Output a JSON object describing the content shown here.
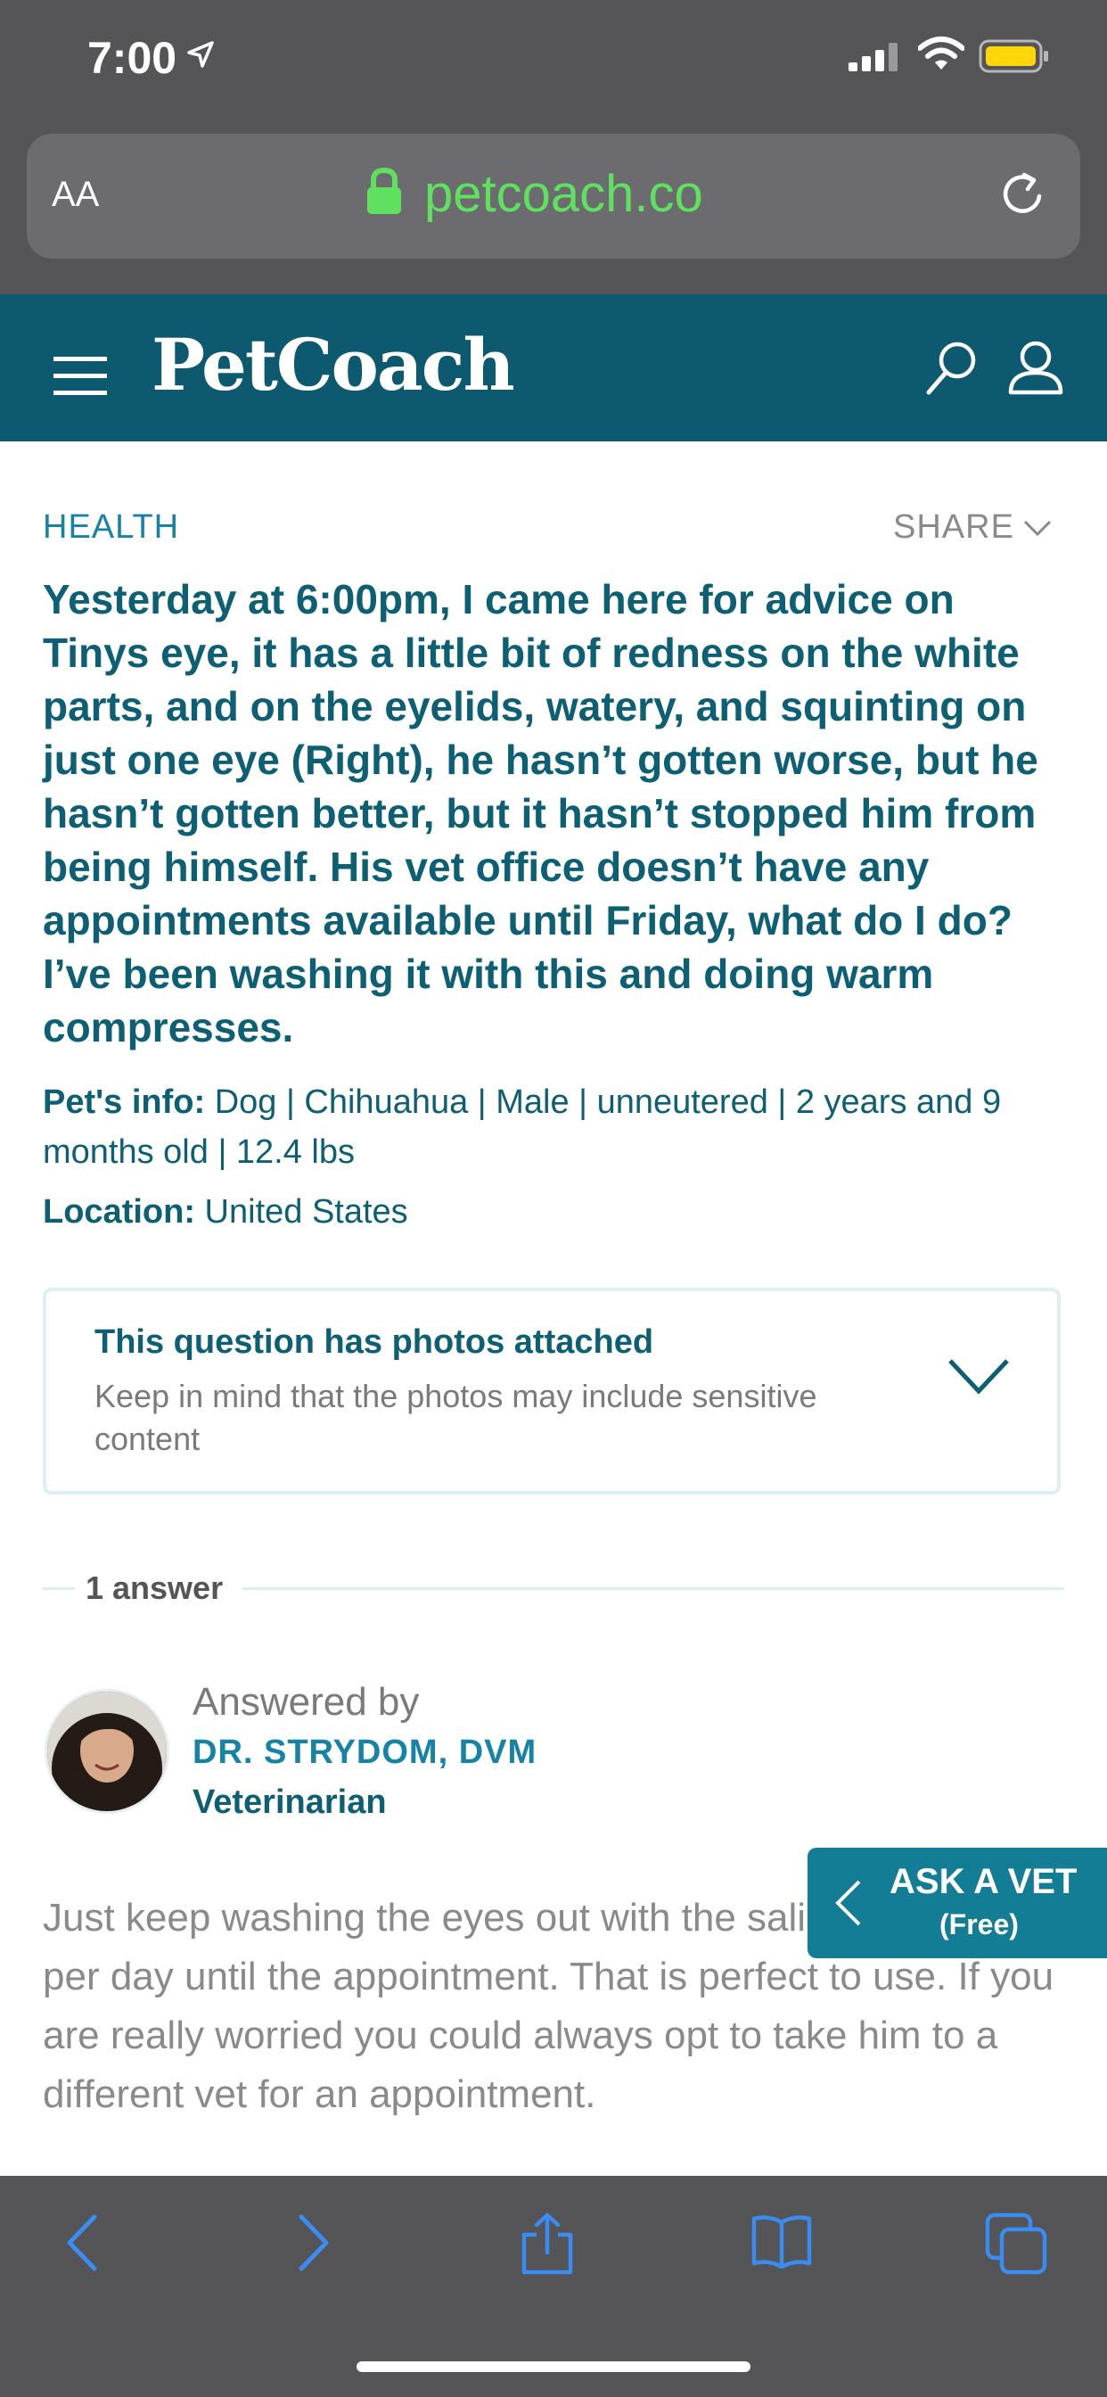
{
  "status_bar": {
    "time": "7:00",
    "icons": [
      "location-arrow-icon",
      "signal-icon",
      "wifi-icon",
      "battery-icon"
    ],
    "battery_color": "#ffd60a"
  },
  "browser": {
    "text_size_label": "AA",
    "url": "petcoach.co",
    "url_color": "#5fe05f",
    "icons": [
      "lock-icon",
      "reload-icon"
    ]
  },
  "site_header": {
    "brand": "PetCoach",
    "background": "#0d5a70",
    "icons": [
      "menu-icon",
      "search-icon",
      "user-icon"
    ]
  },
  "question": {
    "category": "HEALTH",
    "share_label": "SHARE",
    "text": "Yesterday at 6:00pm, I came here for advice on Tinys eye, it has a little bit of redness on the white parts, and on the eyelids, watery, and squinting on just one eye (Right), he hasn’t gotten worse, but he hasn’t gotten better, but it hasn’t stopped him from being himself. His vet office doesn’t have any appointments available until Friday, what do I do? I’ve been washing it with this and doing warm compresses.",
    "pet_info_label": "Pet's info:",
    "pet_info": "Dog | Chihuahua | Male | unneutered | 2 years and 9 months old | 12.4 lbs",
    "location_label": "Location:",
    "location": "United States"
  },
  "photos_notice": {
    "title": "This question has photos attached",
    "subtitle": "Keep in mind that the photos may include sensitive content"
  },
  "answers": {
    "count_label": "1 answer",
    "items": [
      {
        "answered_by_label": "Answered by",
        "vet_name": "DR. STRYDOM, DVM",
        "role": "Veterinarian",
        "text": "Just keep washing the eyes out with the saline 2-3 times per day until the appointment. That is perfect to use. If you are really worried you could always opt to take him to a different vet for an appointment."
      }
    ]
  },
  "ask_vet": {
    "title": "ASK A VET",
    "subtitle": "(Free)"
  },
  "toolbar": {
    "icons": [
      "back-icon",
      "forward-icon",
      "share-icon",
      "bookmarks-icon",
      "tabs-icon"
    ],
    "icon_color": "#3b8cf0"
  }
}
